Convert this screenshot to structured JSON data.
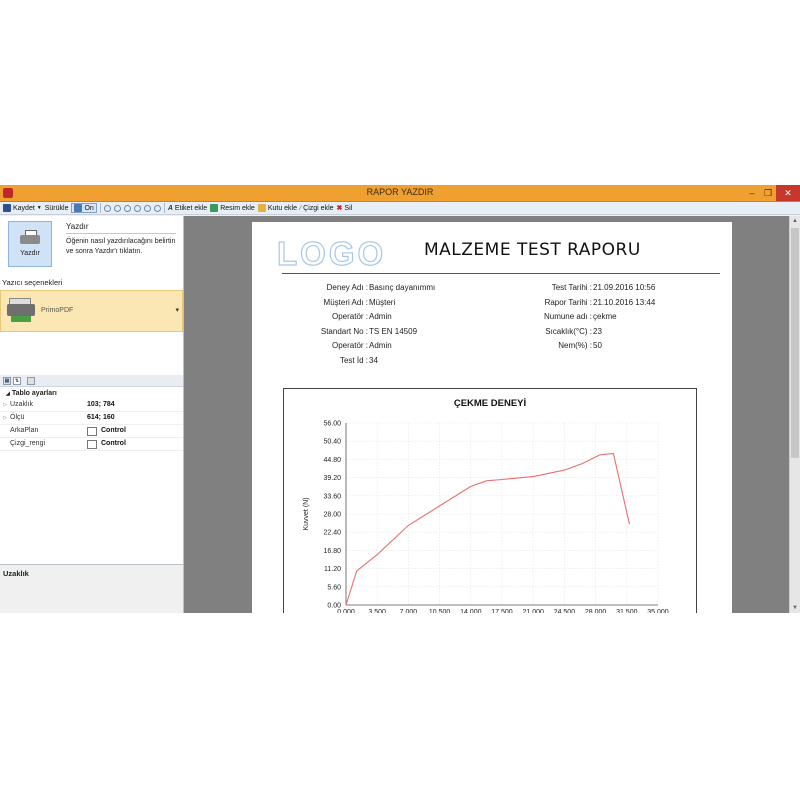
{
  "window": {
    "title": "RAPOR YAZDIR"
  },
  "toolbar": {
    "save": "Kaydet",
    "drag": "Sürükle",
    "on": "On",
    "add_label": "Etiket ekle",
    "add_image": "Resim ekle",
    "add_box": "Kutu ekle",
    "add_line": "Çizgi ekle",
    "delete": "Sil"
  },
  "print_panel": {
    "button_label": "Yazdır",
    "title": "Yazdır",
    "description": "Öğenin nasıl yazdırılacağını belirtin ve sonra Yazdır'ı tıklatın.",
    "printer_section": "Yazıcı seçenekleri",
    "printer_name": "PrimoPDF"
  },
  "properties": {
    "category": "Tablo ayarları",
    "rows": [
      {
        "key": "Uzaklık",
        "value": "103; 784"
      },
      {
        "key": "Ölçü",
        "value": "614; 160"
      },
      {
        "key": "ArkaPlan",
        "value": "Control"
      },
      {
        "key": "Çizgi_rengi",
        "value": "Control"
      }
    ],
    "description_title": "Uzaklık"
  },
  "report": {
    "logo": "LOGO",
    "title": "MALZEME TEST RAPORU",
    "left": [
      {
        "label": "Deney Adı :",
        "value": "Basınç dayanımmı"
      },
      {
        "label": "Müşteri Adı :",
        "value": "Müşteri"
      },
      {
        "label": "Operatör :",
        "value": "Admin"
      },
      {
        "label": "Standart No :",
        "value": "TS EN 14509"
      },
      {
        "label": "Operatör :",
        "value": "Admin"
      },
      {
        "label": "Test İd :",
        "value": "34"
      }
    ],
    "right": [
      {
        "label": "Test Tarihi :",
        "value": "21.09.2016 10:56"
      },
      {
        "label": "Rapor Tarihi :",
        "value": "21.10.2016 13:44"
      },
      {
        "label": "Numune adı :",
        "value": "çekme"
      },
      {
        "label": "Sıcaklık(°C) :",
        "value": "23"
      },
      {
        "label": "Nem(%) :",
        "value": "50"
      }
    ]
  },
  "chart_data": {
    "type": "line",
    "title": "ÇEKME DENEYİ",
    "xlabel": "",
    "ylabel": "Kuvvet (N)",
    "xlim": [
      0,
      35000
    ],
    "ylim": [
      0,
      56
    ],
    "xticks": [
      "0.000",
      "3.500",
      "7.000",
      "10.500",
      "14.000",
      "17.500",
      "21.000",
      "24.500",
      "28.000",
      "31.500",
      "35.000"
    ],
    "yticks": [
      "0.00",
      "5.60",
      "11.20",
      "16.80",
      "22.40",
      "28.00",
      "33.60",
      "39.20",
      "44.80",
      "50.40",
      "56.00"
    ],
    "grid": true,
    "color": "#e87070",
    "x": [
      0,
      1200,
      3500,
      7000,
      10500,
      14000,
      15750,
      17500,
      21000,
      24500,
      26500,
      28500,
      30000,
      31800
    ],
    "y": [
      0,
      10.5,
      15.5,
      24.5,
      30.5,
      36.5,
      38.2,
      38.6,
      39.5,
      41.5,
      43.5,
      46.2,
      46.6,
      24.8
    ]
  }
}
